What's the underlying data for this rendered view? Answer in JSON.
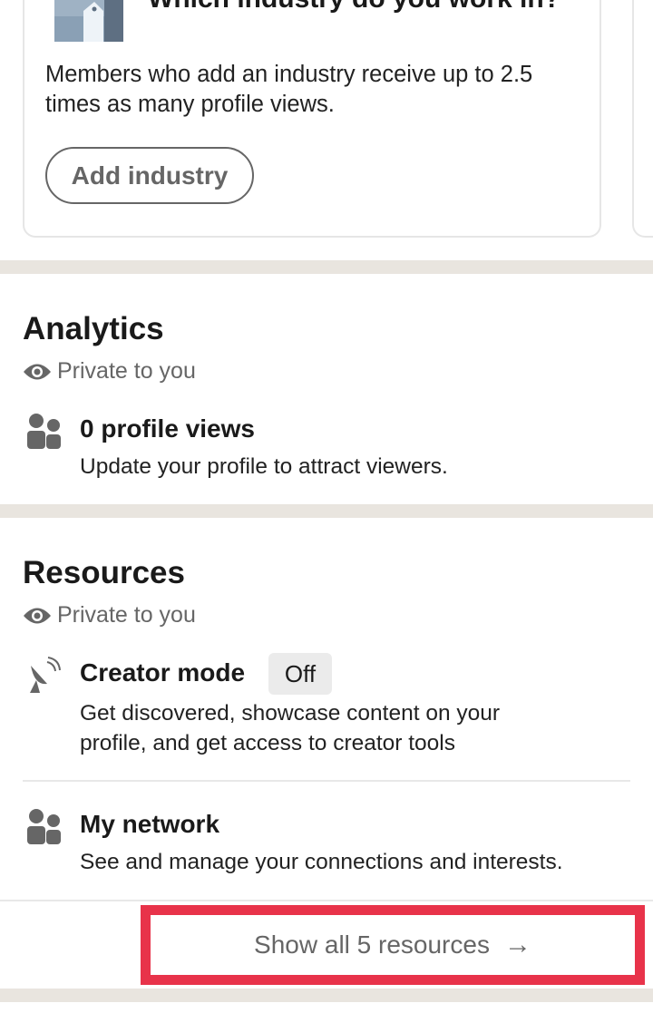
{
  "industry_card": {
    "title": "Which industry do you work in?",
    "description": "Members who add an industry receive up to 2.5 times as many profile views.",
    "button": "Add industry",
    "icon": "building-illustration"
  },
  "analytics": {
    "title": "Analytics",
    "visibility": "Private to you",
    "items": [
      {
        "icon": "people-icon",
        "title": "0 profile views",
        "description": "Update your profile to attract viewers."
      }
    ]
  },
  "resources": {
    "title": "Resources",
    "visibility": "Private to you",
    "items": [
      {
        "icon": "satellite-dish-icon",
        "title": "Creator mode",
        "badge": "Off",
        "description": "Get discovered, showcase content on your profile, and get access to creator tools"
      },
      {
        "icon": "people-icon",
        "title": "My network",
        "description": "See and manage your connections and interests."
      }
    ],
    "show_all": "Show all 5 resources",
    "show_all_icon": "arrow-right-icon"
  },
  "colors": {
    "highlight": "#e8334a",
    "band": "#e9e5df"
  }
}
